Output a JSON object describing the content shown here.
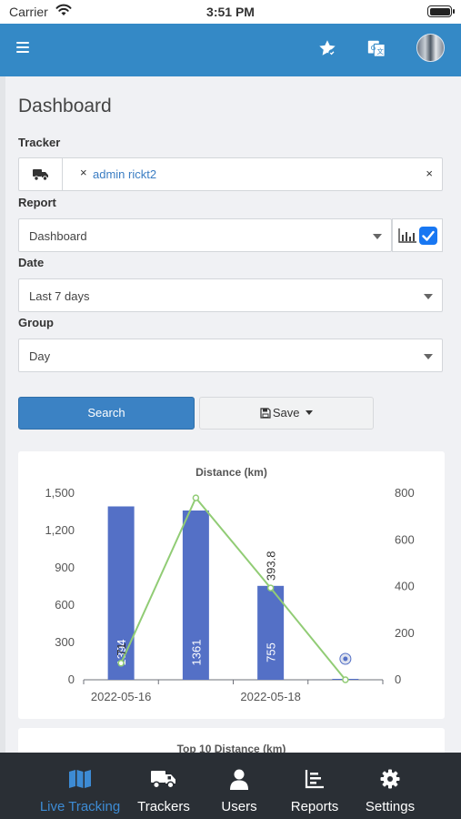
{
  "status_bar": {
    "carrier": "Carrier",
    "time": "3:51 PM"
  },
  "top_bar": {
    "menu_icon": "hamburger-icon",
    "favorites_icon": "star-icon",
    "language_icon": "translate-icon"
  },
  "page_title": "Dashboard",
  "form": {
    "tracker_label": "Tracker",
    "tracker_value": "admin rickt2",
    "chip_remove": "×",
    "clear_all": "×",
    "report_label": "Report",
    "report_value": "Dashboard",
    "chart_toggle_checked": true,
    "date_label": "Date",
    "date_value": "Last 7 days",
    "group_label": "Group",
    "group_value": "Day"
  },
  "buttons": {
    "search": "Search",
    "save": "Save"
  },
  "chart_data": {
    "type": "bar",
    "title": "Distance (km)",
    "categories": [
      "2022-05-16",
      "",
      "2022-05-18",
      ""
    ],
    "x_tick_labels": [
      "2022-05-16",
      "2022-05-18"
    ],
    "series": [
      {
        "values": [
          1394,
          1361,
          755,
          0
        ],
        "axis": "left",
        "color": "#5470c6",
        "value_labels": [
          "1394",
          "1361",
          "755",
          ""
        ]
      },
      {
        "type": "line",
        "values": [
          71,
          780,
          393.8,
          0
        ],
        "axis": "right",
        "color": "#91cc75",
        "value_labels": [
          "71",
          "",
          "393.8",
          ""
        ]
      }
    ],
    "y_left_ticks": [
      "0",
      "300",
      "600",
      "900",
      "1,200",
      "1,500"
    ],
    "y_left_range": [
      0,
      1500
    ],
    "y_right_ticks": [
      "0",
      "200",
      "400",
      "600",
      "800"
    ],
    "y_right_range": [
      0,
      800
    ],
    "grid": false
  },
  "second_card_title": "Top 10 Distance (km)",
  "bottom_nav": [
    {
      "label": "Live Tracking",
      "icon": "map-icon",
      "active": true
    },
    {
      "label": "Trackers",
      "icon": "truck-icon",
      "active": false
    },
    {
      "label": "Users",
      "icon": "user-icon",
      "active": false
    },
    {
      "label": "Reports",
      "icon": "reports-icon",
      "active": false
    },
    {
      "label": "Settings",
      "icon": "gear-icon",
      "active": false
    }
  ],
  "colors": {
    "header": "#3489c6",
    "bar": "#5470c6",
    "line": "#91cc75",
    "nav_bg": "#2a2f35",
    "nav_active": "#3d8bd4"
  }
}
